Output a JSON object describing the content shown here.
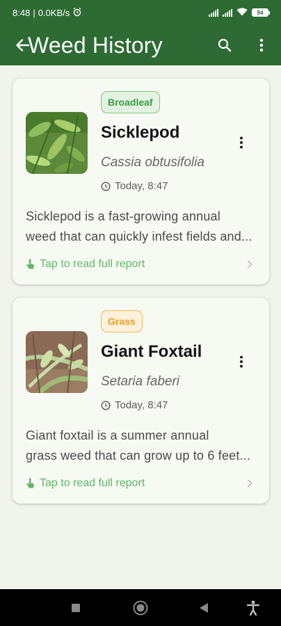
{
  "status": {
    "time": "8:48",
    "speed": "0.0KB/s",
    "battery": "94"
  },
  "appbar": {
    "title": "Weed History"
  },
  "cards": [
    {
      "badge": "Broadleaf",
      "badge_kind": "broadleaf",
      "name": "Sicklepod",
      "scientific": "Cassia obtusifolia",
      "time": "Today, 8:47",
      "desc_line1": "Sicklepod is a fast-growing annual",
      "desc_line2": "weed that can quickly infest fields and...",
      "tap_label": "Tap to read full report"
    },
    {
      "badge": "Grass",
      "badge_kind": "grass",
      "name": "Giant Foxtail",
      "scientific": "Setaria faberi",
      "time": "Today, 8:47",
      "desc_line1": "Giant foxtail is a summer annual",
      "desc_line2": "grass weed that can grow up to 6 feet...",
      "tap_label": "Tap to read full report"
    }
  ],
  "colors": {
    "primary": "#2e6b34",
    "background": "#f0f4ea",
    "broadleaf": "#3c9b45",
    "grass": "#f09c1a",
    "link": "#5fb76a"
  }
}
